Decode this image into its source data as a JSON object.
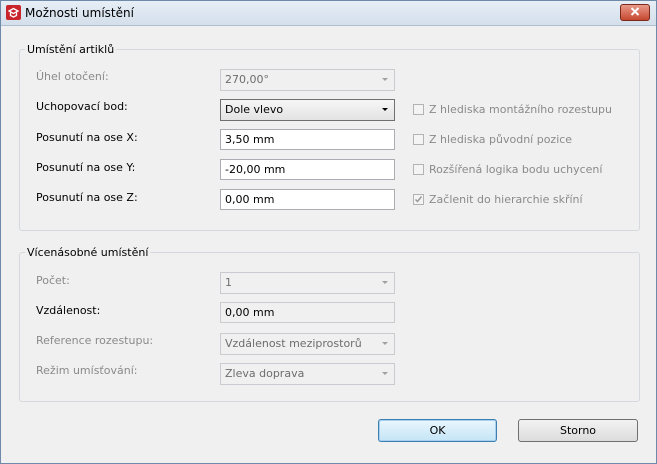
{
  "window": {
    "title": "Možnosti umístění"
  },
  "placement": {
    "group_title": "Umístění artiklů",
    "rotation": {
      "label": "Úhel otočení:",
      "value": "270,00°"
    },
    "grip": {
      "label": "Uchopovací bod:",
      "value": "Dole vlevo"
    },
    "offset_x": {
      "label": "Posunutí na ose X:",
      "value": "3,50 mm"
    },
    "offset_y": {
      "label": "Posunutí na ose Y:",
      "value": "-20,00 mm"
    },
    "offset_z": {
      "label": "Posunutí na ose Z:",
      "value": "0,00 mm"
    },
    "checkboxes": [
      {
        "label": "Z hlediska montážního rozestupu",
        "checked": false
      },
      {
        "label": "Z hlediska původní pozice",
        "checked": false
      },
      {
        "label": "Rozšířená logika bodu uchycení",
        "checked": false
      },
      {
        "label": "Začlenit do hierarchie skříní",
        "checked": true
      }
    ]
  },
  "multi": {
    "group_title": "Vícenásobné umístění",
    "count": {
      "label": "Počet:",
      "value": "1"
    },
    "distance": {
      "label": "Vzdálenost:",
      "value": "0,00 mm"
    },
    "spacing_ref": {
      "label": "Reference rozestupu:",
      "value": "Vzdálenost meziprostorů"
    },
    "mode": {
      "label": "Režim umísťování:",
      "value": "Zleva doprava"
    }
  },
  "buttons": {
    "ok": "OK",
    "cancel": "Storno"
  },
  "colors": {
    "title_bar": "#dbe4ee",
    "close_button": "#c74730",
    "app_icon": "#c9252c",
    "default_button": "#c4e5f6"
  }
}
